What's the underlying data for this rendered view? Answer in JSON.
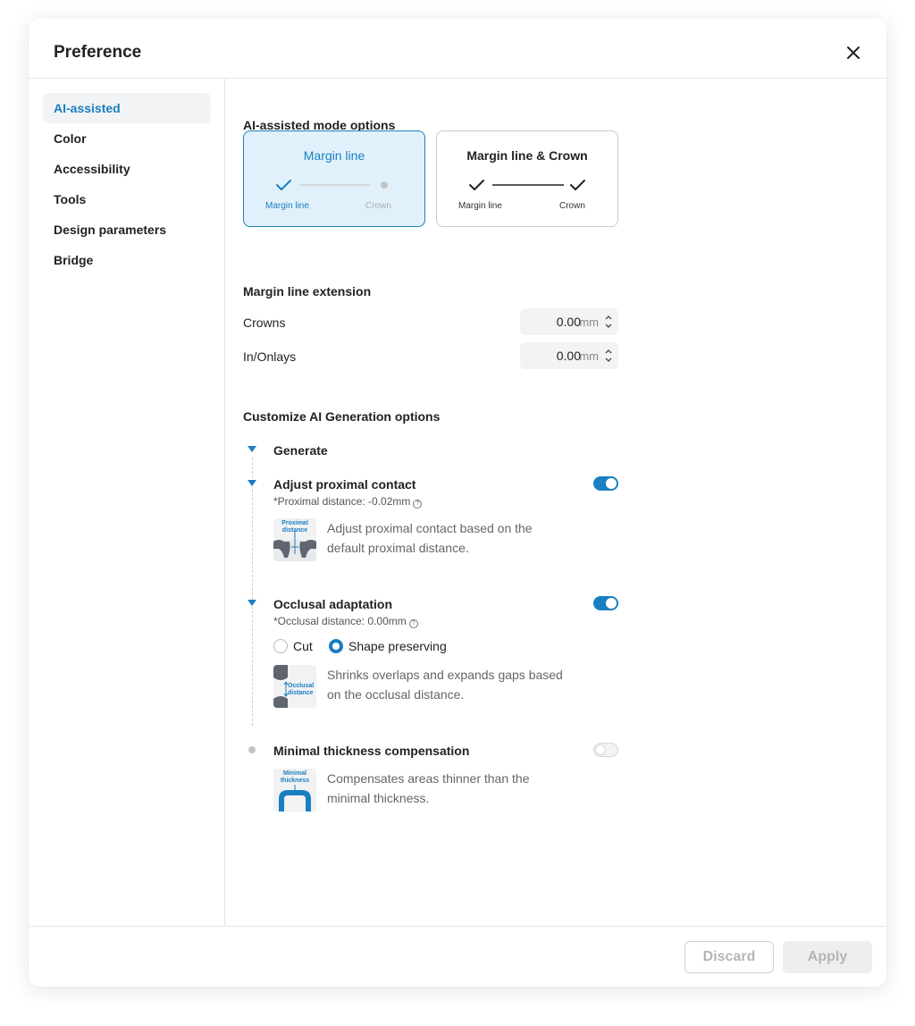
{
  "dialog": {
    "title": "Preference"
  },
  "sidebar": {
    "items": [
      {
        "label": "AI-assisted",
        "active": true
      },
      {
        "label": "Color"
      },
      {
        "label": "Accessibility"
      },
      {
        "label": "Tools"
      },
      {
        "label": "Design parameters"
      },
      {
        "label": "Bridge"
      }
    ]
  },
  "mode_options": {
    "title": "AI-assisted mode options",
    "cards": [
      {
        "title": "Margin line",
        "step1": "Margin line",
        "step2": "Crown",
        "selected": true
      },
      {
        "title": "Margin line & Crown",
        "step1": "Margin line",
        "step2": "Crown",
        "selected": false
      }
    ]
  },
  "extension": {
    "title": "Margin line extension",
    "rows": [
      {
        "label": "Crowns",
        "value": "0.00",
        "unit": "mm"
      },
      {
        "label": "In/Onlays",
        "value": "0.00",
        "unit": "mm"
      }
    ]
  },
  "customize": {
    "title": "Customize AI Generation options",
    "generate": "Generate",
    "proximal": {
      "title": "Adjust proximal contact",
      "sub": "*Proximal distance: -0.02mm",
      "desc": "Adjust proximal contact based on the default proximal distance.",
      "thumb_label": "Proximal distance",
      "enabled": true
    },
    "occlusal": {
      "title": "Occlusal adaptation",
      "sub": "*Occlusal distance: 0.00mm",
      "radio_cut": "Cut",
      "radio_shape": "Shape preserving",
      "selected": "Shape preserving",
      "desc": "Shrinks overlaps and expands gaps based on the occlusal distance.",
      "thumb_label": "Occlusal distance",
      "enabled": true
    },
    "thickness": {
      "title": "Minimal thickness compensation",
      "desc": "Compensates areas thinner than the minimal thickness.",
      "thumb_label": "Minimal thickness",
      "enabled": false
    }
  },
  "footer": {
    "discard": "Discard",
    "apply": "Apply"
  },
  "colors": {
    "accent": "#1a7fc1",
    "selected_bg": "#e1f1fb"
  }
}
